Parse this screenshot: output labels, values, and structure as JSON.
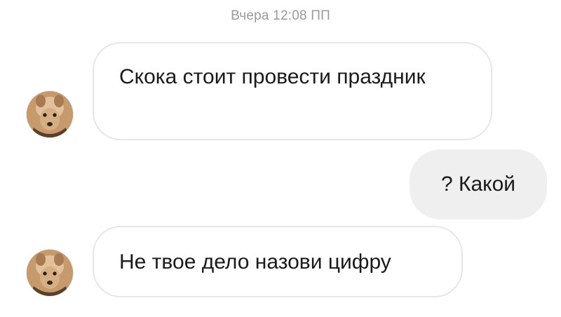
{
  "conversation": {
    "timestamp": "Вчера 12:08 ПП",
    "messages": [
      {
        "direction": "incoming",
        "text": "Скока стоит провести праздник"
      },
      {
        "direction": "outgoing",
        "text": "? Какой"
      },
      {
        "direction": "incoming",
        "text": "Не твое дело назови цифру"
      }
    ]
  },
  "colors": {
    "outgoing_bubble": "#efefef",
    "incoming_border": "#e6e6e6",
    "timestamp_text": "#9a9a9a"
  },
  "icons": {
    "avatar": "contact-avatar-photo"
  }
}
